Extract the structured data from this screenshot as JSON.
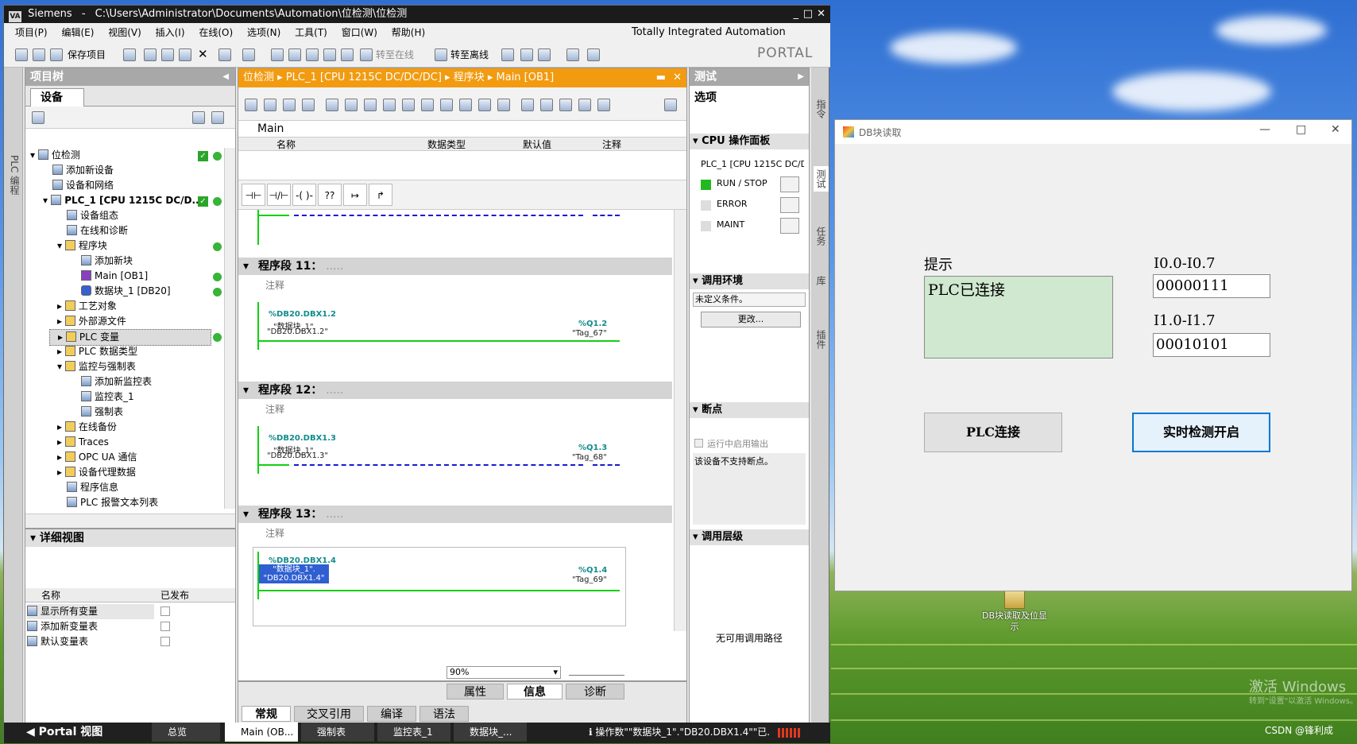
{
  "tia": {
    "title_app": "Siemens",
    "title_sep": "-",
    "title_path": "C:\\Users\\Administrator\\Documents\\Automation\\位检测\\位检测",
    "menu": [
      "项目(P)",
      "编辑(E)",
      "视图(V)",
      "插入(I)",
      "在线(O)",
      "选项(N)",
      "工具(T)",
      "窗口(W)",
      "帮助(H)"
    ],
    "toolbar": {
      "save": "保存项目",
      "go_online": "转至在线",
      "go_offline": "转至离线"
    },
    "brand1": "Totally Integrated Automation",
    "brand2": "PORTAL",
    "left_vtab": "PLC 编程",
    "project_tree": {
      "title": "项目树",
      "tab": "设备",
      "items": [
        "位检测",
        "添加新设备",
        "设备和网络",
        "PLC_1 [CPU 1215C DC/D...",
        "设备组态",
        "在线和诊断",
        "程序块",
        "添加新块",
        "Main [OB1]",
        "数据块_1 [DB20]",
        "工艺对象",
        "外部源文件",
        "PLC 变量",
        "PLC 数据类型",
        "监控与强制表",
        "添加新监控表",
        "监控表_1",
        "强制表",
        "在线备份",
        "Traces",
        "OPC UA 通信",
        "设备代理数据",
        "程序信息",
        "PLC 报警文本列表"
      ]
    },
    "detail_view": {
      "title": "详细视图",
      "col_name": "名称",
      "col_published": "已发布",
      "rows": [
        "显示所有变量",
        "添加新变量表",
        "默认变量表"
      ]
    },
    "editor": {
      "breadcrumb": [
        "位检测",
        "PLC_1 [CPU 1215C DC/DC/DC]",
        "程序块",
        "Main [OB1]"
      ],
      "block_name": "Main",
      "iface_cols": [
        "名称",
        "数据类型",
        "默认值",
        "注释"
      ],
      "comment": "注释",
      "segments": [
        {
          "title": "程序段 11：",
          "dots": ".....",
          "in_addr": "%DB20.DBX1.2",
          "in_name1": "\"数据块_1\".",
          "in_name2": "\"DB20.DBX1.2\"",
          "out_addr": "%Q1.2",
          "out_name": "\"Tag_67\""
        },
        {
          "title": "程序段 12：",
          "dots": ".....",
          "in_addr": "%DB20.DBX1.3",
          "in_name1": "\"数据块_1\".",
          "in_name2": "\"DB20.DBX1.3\"",
          "out_addr": "%Q1.3",
          "out_name": "\"Tag_68\""
        },
        {
          "title": "程序段 13：",
          "dots": ".....",
          "in_addr": "%DB20.DBX1.4",
          "in_name1": "\"数据块_1\".",
          "in_name2": "\"DB20.DBX1.4\"",
          "out_addr": "%Q1.4",
          "out_name": "\"Tag_69\""
        }
      ],
      "zoom": "90%"
    },
    "bottom_panel": {
      "tabs_top": [
        "属性",
        "信息",
        "诊断"
      ],
      "tabs": [
        "常规",
        "交叉引用",
        "编译",
        "语法"
      ]
    },
    "test_panel": {
      "title": "测试",
      "options": "选项",
      "cpu_panel": "CPU 操作面板",
      "cpu_name": "PLC_1 [CPU 1215C DC/D",
      "run_stop": "RUN / STOP",
      "error": "ERROR",
      "maint": "MAINT",
      "call_env": "调用环境",
      "undefined_cond": "未定义条件。",
      "change_btn": "更改...",
      "breakpoints": "断点",
      "run_enable": "运行中启用输出",
      "no_bp": "该设备不支持断点。",
      "call_hierarchy": "调用层级",
      "no_path": "无可用调用路径"
    },
    "right_vtabs": [
      "指令",
      "测试",
      "任务",
      "库",
      "插件"
    ],
    "taskbar": {
      "portal": "Portal 视图",
      "items": [
        "总览",
        "Main (OB...",
        "强制表",
        "监控表_1",
        "数据块_..."
      ],
      "status": "操作数\"\"数据块_1\".\"DB20.DBX1.4\"\"已..."
    }
  },
  "db_window": {
    "title": "DB块读取",
    "hint_label": "提示",
    "hint_text": "PLC已连接",
    "i0_label": "I0.0-I0.7",
    "i0_value": "00000111",
    "i1_label": "I1.0-I1.7",
    "i1_value": "00010101",
    "connect_btn": "PLC连接",
    "monitor_btn": "实时检测开启"
  },
  "desktop": {
    "icon_label": "DB块读取及位显示",
    "watermark1": "激活 Windows",
    "watermark2": "转到\"设置\"以激活 Windows。",
    "csdn": "CSDN @锋利成"
  },
  "colors": {
    "accent_orange": "#f29b10",
    "ok_green": "#38b438",
    "hint_bg": "#cfe8cf",
    "selected_blue": "#2f5fd1"
  }
}
